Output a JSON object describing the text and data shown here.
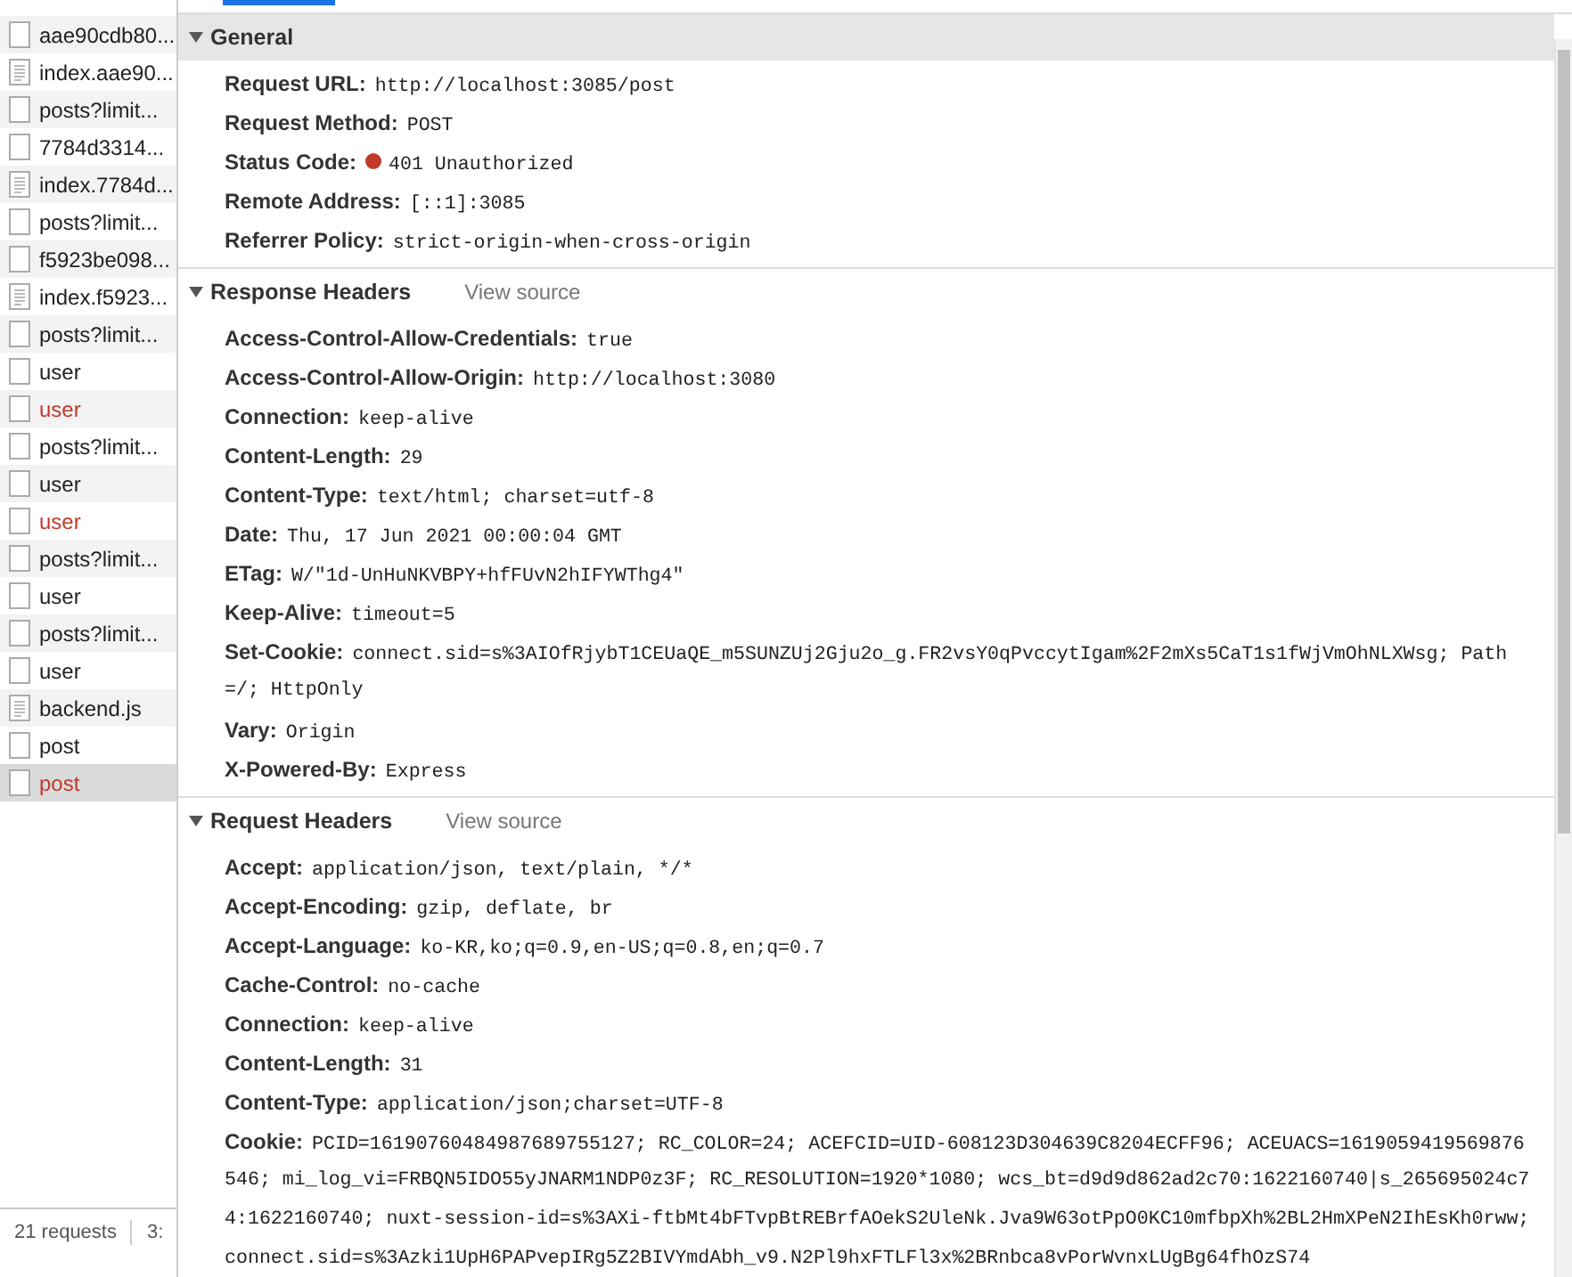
{
  "requests": [
    {
      "name": "aae90cdb80...",
      "kind": "blank",
      "failed": false,
      "selected": false
    },
    {
      "name": "index.aae90...",
      "kind": "document",
      "failed": false,
      "selected": false
    },
    {
      "name": "posts?limit...",
      "kind": "blank",
      "failed": false,
      "selected": false
    },
    {
      "name": "7784d3314...",
      "kind": "blank",
      "failed": false,
      "selected": false
    },
    {
      "name": "index.7784d...",
      "kind": "document",
      "failed": false,
      "selected": false
    },
    {
      "name": "posts?limit...",
      "kind": "blank",
      "failed": false,
      "selected": false
    },
    {
      "name": "f5923be098...",
      "kind": "blank",
      "failed": false,
      "selected": false
    },
    {
      "name": "index.f5923...",
      "kind": "document",
      "failed": false,
      "selected": false
    },
    {
      "name": "posts?limit...",
      "kind": "blank",
      "failed": false,
      "selected": false
    },
    {
      "name": "user",
      "kind": "blank",
      "failed": false,
      "selected": false
    },
    {
      "name": "user",
      "kind": "blank",
      "failed": true,
      "selected": false
    },
    {
      "name": "posts?limit...",
      "kind": "blank",
      "failed": false,
      "selected": false
    },
    {
      "name": "user",
      "kind": "blank",
      "failed": false,
      "selected": false
    },
    {
      "name": "user",
      "kind": "blank",
      "failed": true,
      "selected": false
    },
    {
      "name": "posts?limit...",
      "kind": "blank",
      "failed": false,
      "selected": false
    },
    {
      "name": "user",
      "kind": "blank",
      "failed": false,
      "selected": false
    },
    {
      "name": "posts?limit...",
      "kind": "blank",
      "failed": false,
      "selected": false
    },
    {
      "name": "user",
      "kind": "blank",
      "failed": false,
      "selected": false
    },
    {
      "name": "backend.js",
      "kind": "document",
      "failed": false,
      "selected": false
    },
    {
      "name": "post",
      "kind": "blank",
      "failed": false,
      "selected": false
    },
    {
      "name": "post",
      "kind": "blank",
      "failed": true,
      "selected": true
    }
  ],
  "status_bar": {
    "count": "21 requests",
    "next": "3:"
  },
  "sections": [
    {
      "title": "General",
      "expanded": true,
      "rows": [
        {
          "key": "Request URL:",
          "lines": [
            "http://localhost:3085/post"
          ]
        },
        {
          "key": "Request Method:",
          "lines": [
            "POST"
          ]
        },
        {
          "key": "Status Code:",
          "color": "#c0392b",
          "lines": [
            "401 Unauthorized"
          ]
        },
        {
          "key": "Remote Address:",
          "lines": [
            "[::1]:3085"
          ]
        },
        {
          "key": "Referrer Policy:",
          "lines": [
            "strict-origin-when-cross-origin"
          ]
        }
      ]
    },
    {
      "title": "Response Headers",
      "expanded": true,
      "action": "View source",
      "rows": [
        {
          "key": "Access-Control-Allow-Credentials:",
          "lines": [
            "true"
          ]
        },
        {
          "key": "Access-Control-Allow-Origin:",
          "lines": [
            "http://localhost:3080"
          ]
        },
        {
          "key": "Connection:",
          "lines": [
            "keep-alive"
          ]
        },
        {
          "key": "Content-Length:",
          "lines": [
            "29"
          ]
        },
        {
          "key": "Content-Type:",
          "lines": [
            "text/html; charset=utf-8"
          ]
        },
        {
          "key": "Date:",
          "lines": [
            "Thu, 17 Jun 2021 00:00:04 GMT"
          ]
        },
        {
          "key": "ETag:",
          "lines": [
            "W/\"1d-UnHuNKVBPY+hfFUvN2hIFYWThg4\""
          ]
        },
        {
          "key": "Keep-Alive:",
          "lines": [
            "timeout=5"
          ]
        },
        {
          "key": "Set-Cookie:",
          "lines": [
            "connect.sid=s%3AIOfRjybT1CEUaQE_m5SUNZUj2Gju2o_g.FR2vsY0qPvccytIgam%2F2mXs5CaT1s1fWjVmOhNLXWsg; Path",
            "=/; HttpOnly"
          ]
        },
        {
          "key": "Vary:",
          "lines": [
            "Origin"
          ]
        },
        {
          "key": "X-Powered-By:",
          "lines": [
            "Express"
          ]
        }
      ]
    },
    {
      "title": "Request Headers",
      "expanded": true,
      "action": "View source",
      "rows": [
        {
          "key": "Accept:",
          "lines": [
            "application/json, text/plain, */*"
          ]
        },
        {
          "key": "Accept-Encoding:",
          "lines": [
            "gzip, deflate, br"
          ]
        },
        {
          "key": "Accept-Language:",
          "lines": [
            "ko-KR,ko;q=0.9,en-US;q=0.8,en;q=0.7"
          ]
        },
        {
          "key": "Cache-Control:",
          "lines": [
            "no-cache"
          ]
        },
        {
          "key": "Connection:",
          "lines": [
            "keep-alive"
          ]
        },
        {
          "key": "Content-Length:",
          "lines": [
            "31"
          ]
        },
        {
          "key": "Content-Type:",
          "lines": [
            "application/json;charset=UTF-8"
          ]
        },
        {
          "key": "Cookie:",
          "lines": [
            "PCID=16190760484987689755127; RC_COLOR=24; ACEFCID=UID-608123D304639C8204ECFF96; ACEUACS=1619059419569876",
            "546; mi_log_vi=FRBQN5IDO55yJNARM1NDP0z3F; RC_RESOLUTION=1920*1080; wcs_bt=d9d9d862ad2c70:1622160740|s_265695024c7",
            "4:1622160740; nuxt-session-id=s%3AXi-ftbMt4bFTvpBtREBrfAOekS2UleNk.Jva9W63otPpO0KC10mfbpXh%2BL2HmXPeN2IhEsKh0rww;",
            "connect.sid=s%3Azki1UpH6PAPvepIRg5Z2BIVYmdAbh_v9.N2Pl9hxFTLFl3x%2BRnbca8vPorWvnxLUgBg64fhOzS74"
          ]
        }
      ]
    }
  ]
}
